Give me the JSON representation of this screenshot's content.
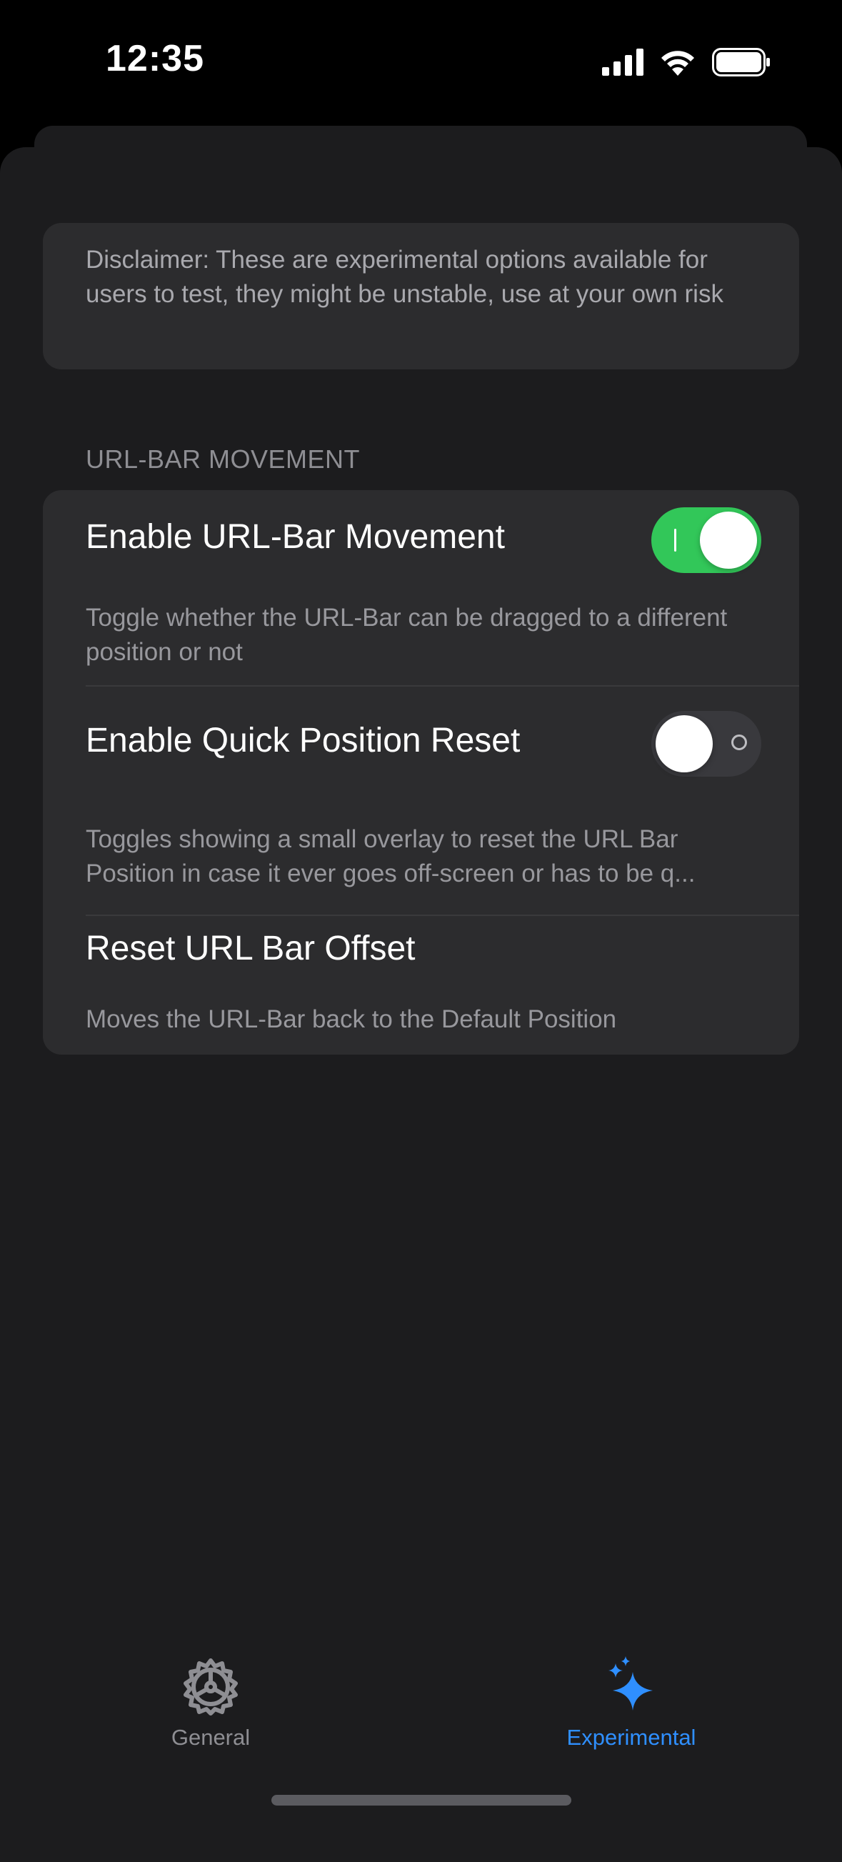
{
  "status_bar": {
    "time": "12:35",
    "icons": [
      "cellular-signal-icon",
      "wifi-icon",
      "battery-icon"
    ]
  },
  "disclaimer": {
    "text": "Disclaimer: These are experimental options available for users to test, they might be unstable, use at your own risk"
  },
  "section": {
    "header": "URL-BAR MOVEMENT"
  },
  "settings": {
    "url_bar_movement": {
      "title": "Enable URL-Bar Movement",
      "description": "Toggle whether the URL-Bar can be dragged to a different position or not",
      "enabled": true
    },
    "quick_position_reset": {
      "title": "Enable Quick Position Reset",
      "description": "Toggles showing a small overlay to reset the URL Bar Position in case it ever goes off-screen or has to be q...",
      "enabled": false
    },
    "reset_offset": {
      "title": "Reset URL Bar Offset",
      "description": "Moves the URL-Bar back to the Default Position"
    }
  },
  "tab_bar": {
    "tabs": [
      {
        "label": "General",
        "icon": "gear-icon",
        "selected": false
      },
      {
        "label": "Experimental",
        "icon": "sparkles-icon",
        "selected": true
      }
    ]
  },
  "colors": {
    "toggle_on": "#32c759",
    "accent": "#2f8fff",
    "background": "#1c1c1e",
    "card": "#2c2c2e"
  }
}
